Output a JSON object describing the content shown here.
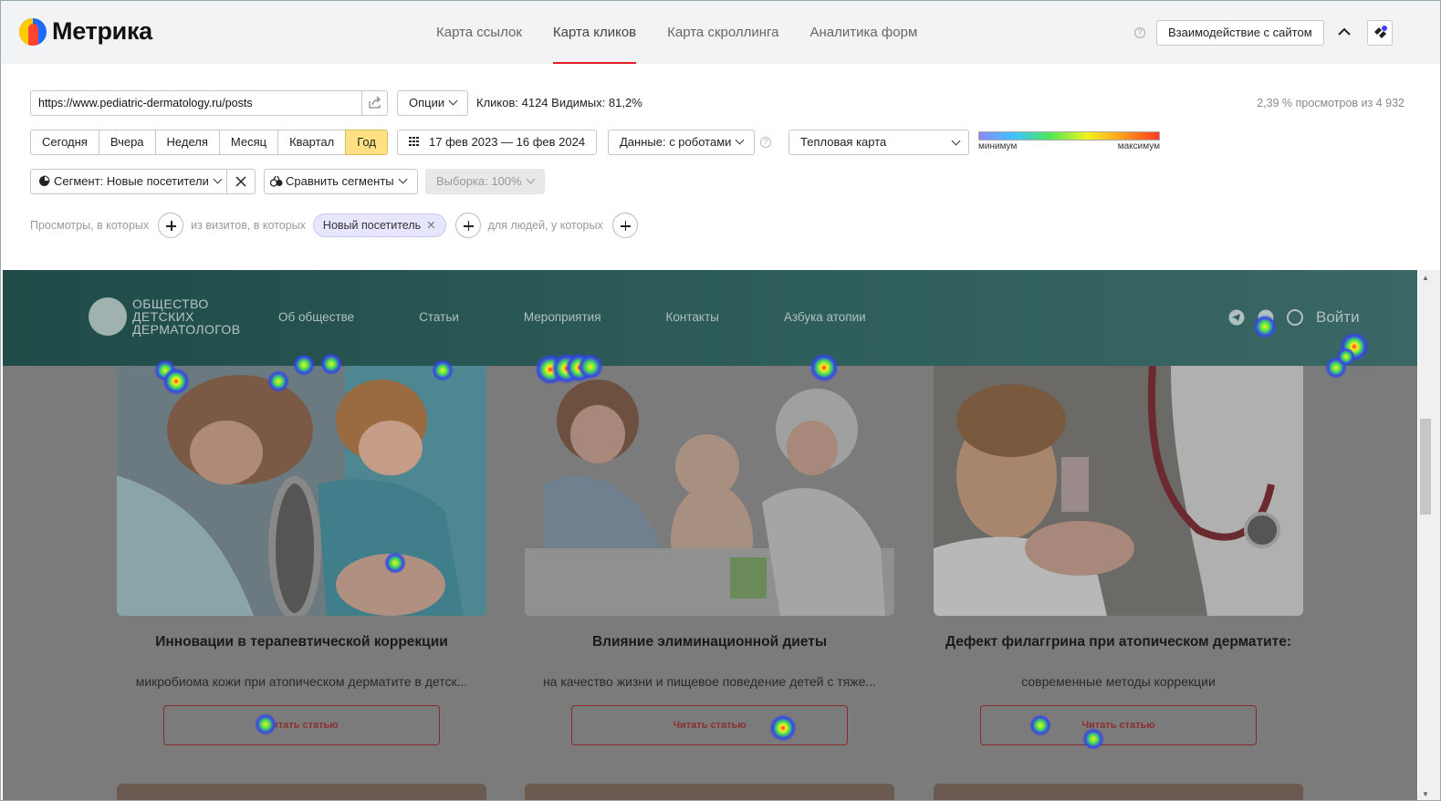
{
  "app": {
    "brand": "Метрика"
  },
  "tabs": [
    {
      "label": "Карта ссылок",
      "active": false
    },
    {
      "label": "Карта кликов",
      "active": true
    },
    {
      "label": "Карта скроллинга",
      "active": false
    },
    {
      "label": "Аналитика форм",
      "active": false
    }
  ],
  "header": {
    "interact_label": "Взаимодействие с сайтом",
    "help_glyph": "?"
  },
  "controls": {
    "url": "https://www.pediatric-dermatology.ru/posts",
    "options_label": "Опции",
    "stats": "Кликов: 4124  Видимых: 81,2%",
    "views": "2,39 % просмотров из 4 932",
    "periods": [
      "Сегодня",
      "Вчера",
      "Неделя",
      "Месяц",
      "Квартал",
      "Год"
    ],
    "active_period": "Год",
    "date_range": "17 фев 2023 — 16 фев 2024",
    "data_label": "Данные: с роботами",
    "map_type": "Тепловая карта",
    "legend_min": "минимум",
    "legend_max": "максимум",
    "segment_label": "Сегмент: Новые посетители",
    "compare_label": "Сравнить сегменты",
    "sample_label": "Выборка: 100%"
  },
  "filters": {
    "views_label": "Просмотры, в которых",
    "visits_label": "из визитов, в которых",
    "chip_label": "Новый посетитель",
    "people_label": "для людей, у которых"
  },
  "site": {
    "logo_lines": [
      "Общество",
      "детских",
      "дерматологов"
    ],
    "nav": [
      "Об обществе",
      "Статьи",
      "Мероприятия",
      "Контакты",
      "Азбука атопии"
    ],
    "login": "Войти",
    "cards": [
      {
        "title": "Инновации в терапевтической коррекции",
        "subtitle": "микробиома кожи при атопическом дерматите в детск...",
        "button": "Читать статью"
      },
      {
        "title": "Влияние элиминационной диеты",
        "subtitle": "на качество жизни и пищевое поведение детей с тяже...",
        "button": "Читать статью"
      },
      {
        "title": "Дефект филаггрина при атопическом дерматите:",
        "subtitle": "современные методы коррекции",
        "button": "Читать статью"
      }
    ]
  },
  "heatmap_colors": {
    "outer": "#3346e8",
    "mid": "#4de84d",
    "hot": "#ffe81e",
    "core": "#ff2a1e"
  }
}
